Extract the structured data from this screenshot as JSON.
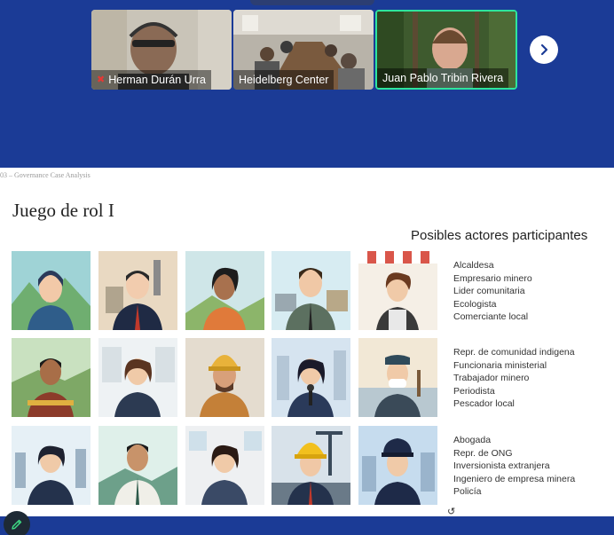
{
  "participants": [
    {
      "name": "Herman Durán Urra",
      "muted": true
    },
    {
      "name": "Heidelberg Center",
      "muted": false
    },
    {
      "name": "Juan Pablo Tribin Rivera",
      "muted": false,
      "active_speaker": true
    }
  ],
  "controls": {
    "next_icon": "chevron-right-icon",
    "edit_icon": "pencil-icon"
  },
  "slide": {
    "header": "03 – Governance Case Analysis",
    "title": "Juego de rol I",
    "subtitle": "Posibles actores participantes",
    "groups": [
      {
        "items": [
          "Alcaldesa",
          "Empresario minero",
          "Lider comunitaria",
          "Ecologista",
          "Comerciante local"
        ]
      },
      {
        "items": [
          "Repr. de comunidad indigena",
          "Funcionaria ministerial",
          "Trabajador minero",
          "Periodista",
          "Pescador local"
        ]
      },
      {
        "items": [
          "Abogada",
          "Repr. de ONG",
          "Inversionista extranjera",
          "Ingeniero de empresa minera",
          "Policía"
        ]
      }
    ]
  },
  "colors": {
    "accent": "#1b3b96",
    "active_border": "#2ee59d",
    "muted": "#e53935"
  }
}
